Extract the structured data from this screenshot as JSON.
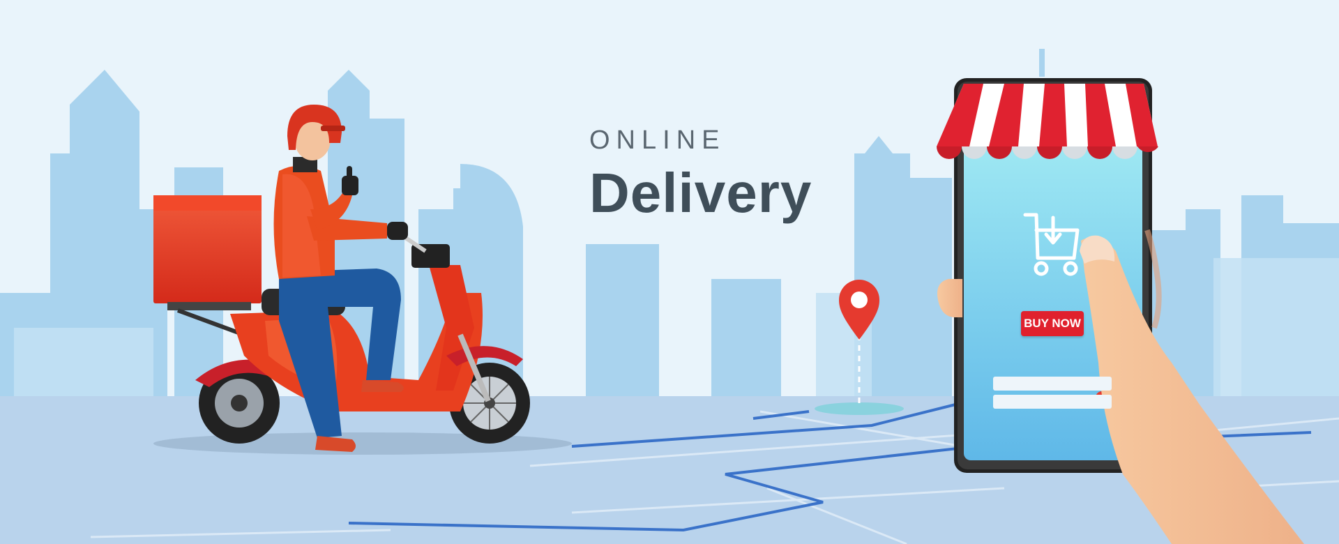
{
  "headline": {
    "sub": "ONLINE",
    "main": "Delivery"
  },
  "phone": {
    "buy_button": "BUY NOW",
    "icons": [
      "cart-download-icon",
      "location-pin-icon",
      "circle-target-icon"
    ]
  },
  "colors": {
    "sky": "#e8f3fa",
    "buildings": "#a9d3ee",
    "road": "#b9d3ec",
    "route": "#3a72c9",
    "accent": "#e0212d",
    "rider": "#e8401f",
    "text": "#3f4e59"
  }
}
